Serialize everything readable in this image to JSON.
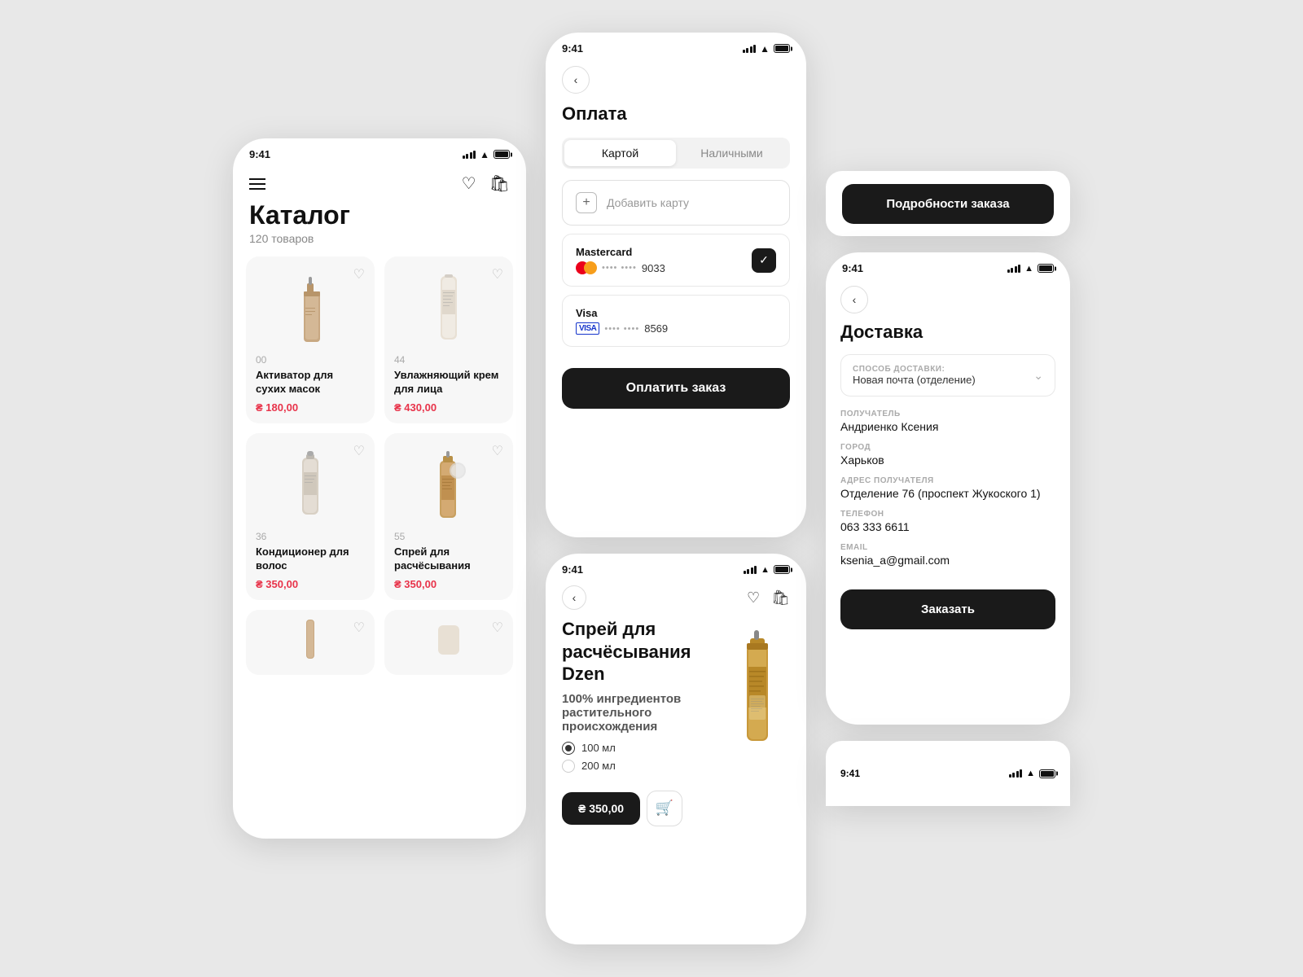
{
  "app": {
    "background": "#e8e8e8"
  },
  "phone_catalog": {
    "status_time": "9:41",
    "nav": {
      "wishlist_icon": "♡",
      "cart_icon": "🛍"
    },
    "title": "Каталог",
    "subtitle": "120 товаров",
    "products": [
      {
        "id": "00",
        "name": "Активатор для сухих масок",
        "price": "₴ 180,00",
        "type": "pump"
      },
      {
        "id": "44",
        "name": "Увлажняющий крем для лица",
        "price": "₴ 430,00",
        "type": "cream"
      },
      {
        "id": "36",
        "name": "Кондиционер для волос",
        "price": "₴ 350,00",
        "type": "tube"
      },
      {
        "id": "55",
        "name": "Спрей для расчёсывания",
        "price": "₴ 350,00",
        "type": "spray"
      }
    ]
  },
  "phone_payment": {
    "status_time": "9:41",
    "back_icon": "‹",
    "title": "Оплата",
    "tabs": [
      {
        "label": "Картой",
        "active": true
      },
      {
        "label": "Наличными",
        "active": false
      }
    ],
    "add_card": {
      "plus": "+",
      "text": "Добавить карту"
    },
    "cards": [
      {
        "brand": "Mastercard",
        "type": "mastercard",
        "dots": "•••• ••••",
        "last4": "9033",
        "selected": true
      },
      {
        "brand": "Visa",
        "type": "visa",
        "dots": "•••• ••••",
        "last4": "8569",
        "selected": false
      }
    ],
    "pay_button": "Оплатить заказ"
  },
  "phone_product": {
    "status_time": "9:41",
    "back_icon": "‹",
    "wishlist_icon": "♡",
    "cart_icon": "🛍",
    "title": "Спрей для расчёсывания Dzen",
    "badge_percent": "100",
    "badge_text": "% ингредиентов растительного происхождения",
    "options": [
      {
        "label": "100 мл",
        "selected": true
      },
      {
        "label": "200 мл",
        "selected": false
      }
    ],
    "price": "₴ 350,00",
    "cart_icon_btn": "🛒"
  },
  "phone_order_btn": {
    "button_label": "Подробности заказа"
  },
  "phone_delivery": {
    "status_time": "9:41",
    "back_icon": "‹",
    "title": "Доставка",
    "delivery_method_label": "Способ доставки:",
    "delivery_method_value": "Новая почта (отделение)",
    "fields": [
      {
        "label": "ПОЛУЧАТЕЛЬ",
        "value": "Андриенко Ксения"
      },
      {
        "label": "ГОРОД",
        "value": "Харьков"
      },
      {
        "label": "АДРЕС ПОЛУЧАТЕЛЯ",
        "value": "Отделение 76 (проспект Жукоского 1)"
      },
      {
        "label": "ТЕЛЕФОН",
        "value": "063 333 6611"
      },
      {
        "label": "EMAIL",
        "value": "ksenia_a@gmail.com"
      }
    ],
    "order_button": "Заказать"
  },
  "phone_partial": {
    "status_time": "9:41"
  }
}
